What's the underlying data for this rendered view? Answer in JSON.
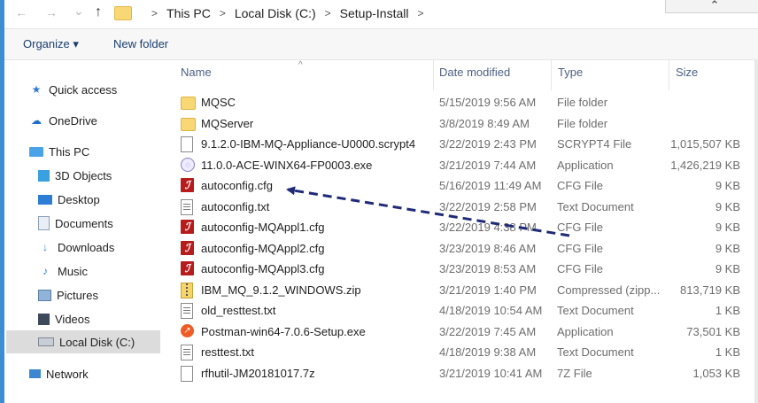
{
  "nav_buttons": {
    "back": "←",
    "forward": "→",
    "recent": "⌄",
    "up": "↑"
  },
  "breadcrumb": [
    "This PC",
    "Local Disk (C:)",
    "Setup-Install"
  ],
  "breadcrumb_sep": ">",
  "collapse_glyph": "⌃",
  "toolbar": {
    "organize": "Organize ▾",
    "new_folder": "New folder"
  },
  "sidebar": [
    {
      "label": "Quick access",
      "icon": "star-icon"
    },
    {
      "label": "OneDrive",
      "icon": "cloud-icon"
    },
    {
      "label": "This PC",
      "icon": "computer-icon"
    },
    {
      "label": "3D Objects",
      "icon": "cube-icon"
    },
    {
      "label": "Desktop",
      "icon": "desktop-icon"
    },
    {
      "label": "Documents",
      "icon": "documents-icon"
    },
    {
      "label": "Downloads",
      "icon": "download-icon"
    },
    {
      "label": "Music",
      "icon": "music-icon"
    },
    {
      "label": "Pictures",
      "icon": "pictures-icon"
    },
    {
      "label": "Videos",
      "icon": "videos-icon"
    },
    {
      "label": "Local Disk (C:)",
      "icon": "drive-icon"
    },
    {
      "label": "Network",
      "icon": "network-icon"
    }
  ],
  "columns": {
    "name": "Name",
    "date": "Date modified",
    "type": "Type",
    "size": "Size"
  },
  "files": [
    {
      "name": "MQSC",
      "date": "5/15/2019 9:56 AM",
      "type": "File folder",
      "size": "",
      "icon": "folder"
    },
    {
      "name": "MQServer",
      "date": "3/8/2019 8:49 AM",
      "type": "File folder",
      "size": "",
      "icon": "folder"
    },
    {
      "name": "9.1.2.0-IBM-MQ-Appliance-U0000.scrypt4",
      "date": "3/22/2019 2:43 PM",
      "type": "SCRYPT4 File",
      "size": "1,015,507 KB",
      "icon": "doc"
    },
    {
      "name": "11.0.0-ACE-WINX64-FP0003.exe",
      "date": "3/21/2019 7:44 AM",
      "type": "Application",
      "size": "1,426,219 KB",
      "icon": "app"
    },
    {
      "name": "autoconfig.cfg",
      "date": "5/16/2019 11:49 AM",
      "type": "CFG File",
      "size": "9 KB",
      "icon": "cfg"
    },
    {
      "name": "autoconfig.txt",
      "date": "3/22/2019 2:58 PM",
      "type": "Text Document",
      "size": "9 KB",
      "icon": "txt"
    },
    {
      "name": "autoconfig-MQAppl1.cfg",
      "date": "3/22/2019 4:38 PM",
      "type": "CFG File",
      "size": "9 KB",
      "icon": "cfg"
    },
    {
      "name": "autoconfig-MQAppl2.cfg",
      "date": "3/23/2019 8:46 AM",
      "type": "CFG File",
      "size": "9 KB",
      "icon": "cfg"
    },
    {
      "name": "autoconfig-MQAppl3.cfg",
      "date": "3/23/2019 8:53 AM",
      "type": "CFG File",
      "size": "9 KB",
      "icon": "cfg"
    },
    {
      "name": "IBM_MQ_9.1.2_WINDOWS.zip",
      "date": "3/21/2019 1:40 PM",
      "type": "Compressed (zipp...",
      "size": "813,719 KB",
      "icon": "zip"
    },
    {
      "name": "old_resttest.txt",
      "date": "4/18/2019 10:54 AM",
      "type": "Text Document",
      "size": "1 KB",
      "icon": "txt"
    },
    {
      "name": "Postman-win64-7.0.6-Setup.exe",
      "date": "3/22/2019 7:45 AM",
      "type": "Application",
      "size": "73,501 KB",
      "icon": "postman"
    },
    {
      "name": "resttest.txt",
      "date": "4/18/2019 9:38 AM",
      "type": "Text Document",
      "size": "1 KB",
      "icon": "txt"
    },
    {
      "name": "rfhutil-JM20181017.7z",
      "date": "3/21/2019 10:41 AM",
      "type": "7Z File",
      "size": "1,053 KB",
      "icon": "doc"
    }
  ],
  "colors": {
    "accent": "#3b8ed6",
    "arrow": "#1f2a78",
    "cfg_icon": "#b71c1c"
  }
}
